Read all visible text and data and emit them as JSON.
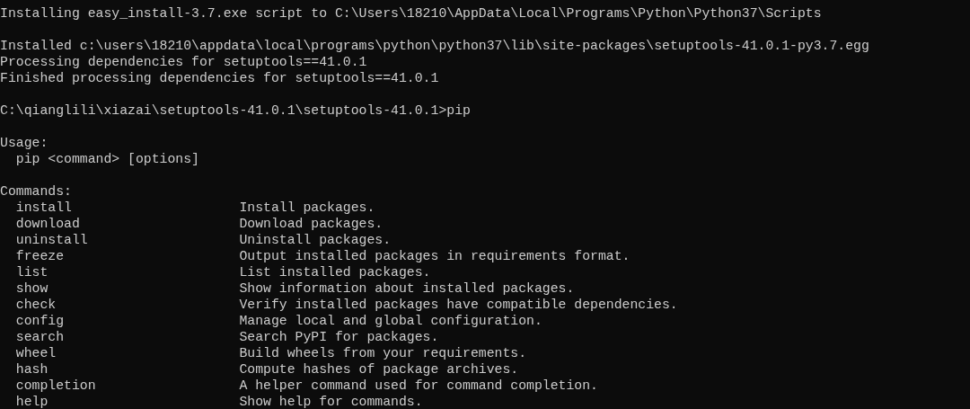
{
  "console": {
    "blocks": [
      {
        "lines": [
          "Installing easy_install-3.7.exe script to C:\\Users\\18210\\AppData\\Local\\Programs\\Python\\Python37\\Scripts"
        ]
      },
      {
        "lines": [
          "Installed c:\\users\\18210\\appdata\\local\\programs\\python\\python37\\lib\\site-packages\\setuptools-41.0.1-py3.7.egg",
          "Processing dependencies for setuptools==41.0.1",
          "Finished processing dependencies for setuptools==41.0.1"
        ]
      },
      {
        "lines": [
          "C:\\qianglili\\xiazai\\setuptools-41.0.1\\setuptools-41.0.1>pip"
        ]
      }
    ],
    "usage": {
      "heading": "Usage:",
      "line": "pip <command> [options]"
    },
    "commands": {
      "heading": "Commands:",
      "items": [
        {
          "name": "install",
          "description": "Install packages."
        },
        {
          "name": "download",
          "description": "Download packages."
        },
        {
          "name": "uninstall",
          "description": "Uninstall packages."
        },
        {
          "name": "freeze",
          "description": "Output installed packages in requirements format."
        },
        {
          "name": "list",
          "description": "List installed packages."
        },
        {
          "name": "show",
          "description": "Show information about installed packages."
        },
        {
          "name": "check",
          "description": "Verify installed packages have compatible dependencies."
        },
        {
          "name": "config",
          "description": "Manage local and global configuration."
        },
        {
          "name": "search",
          "description": "Search PyPI for packages."
        },
        {
          "name": "wheel",
          "description": "Build wheels from your requirements."
        },
        {
          "name": "hash",
          "description": "Compute hashes of package archives."
        },
        {
          "name": "completion",
          "description": "A helper command used for command completion."
        },
        {
          "name": "help",
          "description": "Show help for commands."
        }
      ]
    }
  }
}
